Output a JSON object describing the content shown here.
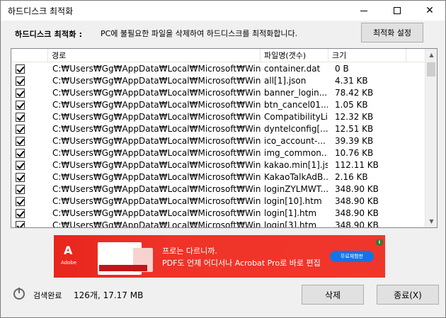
{
  "window": {
    "title": "하드디스크 최적화"
  },
  "header": {
    "label": "하드디스크 최적화 :",
    "description": "PC에 불필요한 파일을 삭제하여 하드디스크를 최적화합니다.",
    "settings_button": "최적화 설정"
  },
  "table": {
    "columns": [
      "",
      "경로",
      "파일명(갯수)",
      "크기"
    ],
    "rows": [
      {
        "checked": true,
        "path": "C:₩Users₩Gg₩AppData₩Local₩Microsoft₩Wind...",
        "name": "container.dat",
        "size": "0 B"
      },
      {
        "checked": true,
        "path": "C:₩Users₩Gg₩AppData₩Local₩Microsoft₩Wind...",
        "name": "all[1].json",
        "size": "4.31 KB"
      },
      {
        "checked": true,
        "path": "C:₩Users₩Gg₩AppData₩Local₩Microsoft₩Wind...",
        "name": "banner_login...",
        "size": "78.42 KB"
      },
      {
        "checked": true,
        "path": "C:₩Users₩Gg₩AppData₩Local₩Microsoft₩Wind...",
        "name": "btn_cancel01...",
        "size": "1.05 KB"
      },
      {
        "checked": true,
        "path": "C:₩Users₩Gg₩AppData₩Local₩Microsoft₩Wind...",
        "name": "CompatibilityLi...",
        "size": "12.32 KB"
      },
      {
        "checked": true,
        "path": "C:₩Users₩Gg₩AppData₩Local₩Microsoft₩Wind...",
        "name": "dyntelconfig[...",
        "size": "12.51 KB"
      },
      {
        "checked": true,
        "path": "C:₩Users₩Gg₩AppData₩Local₩Microsoft₩Wind...",
        "name": "ico_account-...",
        "size": "39.39 KB"
      },
      {
        "checked": true,
        "path": "C:₩Users₩Gg₩AppData₩Local₩Microsoft₩Wind...",
        "name": "img_common...",
        "size": "10.76 KB"
      },
      {
        "checked": true,
        "path": "C:₩Users₩Gg₩AppData₩Local₩Microsoft₩Wind...",
        "name": "kakao.min[1].js",
        "size": "112.11 KB"
      },
      {
        "checked": true,
        "path": "C:₩Users₩Gg₩AppData₩Local₩Microsoft₩Wind...",
        "name": "KakaoTalkAdB...",
        "size": "2.16 KB"
      },
      {
        "checked": true,
        "path": "C:₩Users₩Gg₩AppData₩Local₩Microsoft₩Wind...",
        "name": "loginZYLMWT...",
        "size": "348.90 KB"
      },
      {
        "checked": true,
        "path": "C:₩Users₩Gg₩AppData₩Local₩Microsoft₩Wind...",
        "name": "login[10].htm",
        "size": "348.90 KB"
      },
      {
        "checked": true,
        "path": "C:₩Users₩Gg₩AppData₩Local₩Microsoft₩Wind...",
        "name": "login[1].htm",
        "size": "348.90 KB"
      },
      {
        "checked": true,
        "path": "C:₩Users₩Gg₩AppData₩Local₩Microsoft₩Wind...",
        "name": "login[3].htm",
        "size": "348.90 KB"
      }
    ]
  },
  "ad": {
    "brand": "Adobe",
    "line1": "프로는 다르니까.",
    "line2": "PDF도 언제 어디서나 Acrobat Pro로 바로 편집",
    "cta": "무료체험판",
    "info": "i"
  },
  "status": {
    "label": "검색완료",
    "summary": "126개, 17.17 MB"
  },
  "buttons": {
    "delete": "삭제",
    "exit": "종료(X)"
  },
  "colors": {
    "ad_red": "#f0362b",
    "ad_cta_blue": "#1473e6"
  }
}
